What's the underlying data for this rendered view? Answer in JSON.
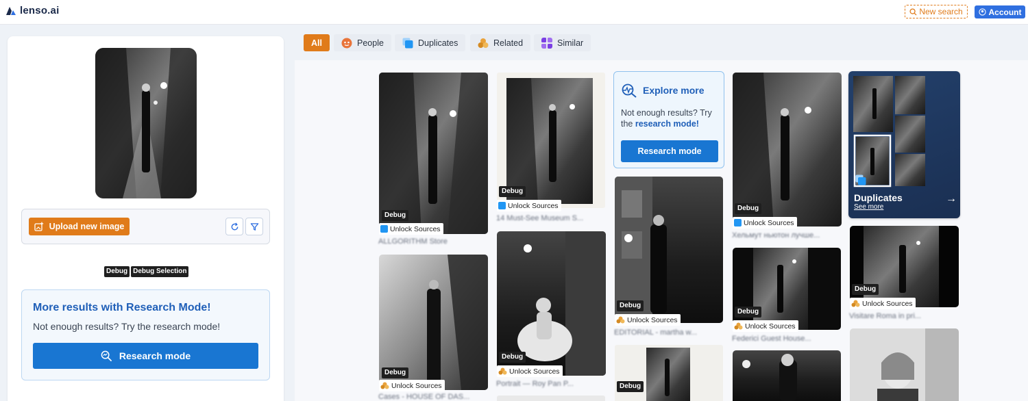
{
  "header": {
    "logo_text": "lenso.ai",
    "new_search_label": "New search",
    "account_label": "Account"
  },
  "left_panel": {
    "upload_label": "Upload new image",
    "debug_tags": [
      "Debug",
      "Debug Selection"
    ],
    "research_card": {
      "title": "More results with Research Mode!",
      "subtitle": "Not enough results? Try the research mode!",
      "button_label": "Research mode"
    }
  },
  "tabs": [
    {
      "label": "All",
      "icon": "all"
    },
    {
      "label": "People",
      "icon": "people-icon"
    },
    {
      "label": "Duplicates",
      "icon": "duplicates-icon"
    },
    {
      "label": "Related",
      "icon": "related-icon"
    },
    {
      "label": "Similar",
      "icon": "similar-icon"
    }
  ],
  "results": {
    "debug_label": "Debug",
    "unlock_label": "Unlock Sources",
    "titles": [
      "ALLGORITHM Store",
      "14 Must-See Museum S...",
      "Хельмут ньютон лучше...",
      "EDITORIAL - martha w...",
      "Visitare Roma in pri...",
      "Cases - HOUSE OF DAS...",
      "Portrait — Roy Pan P...",
      "Federici Guest House..."
    ]
  },
  "explore": {
    "title": "Explore more",
    "text_before": "Not enough results? Try the ",
    "text_bold": "research mode!",
    "button_label": "Research mode"
  },
  "duplicates_card": {
    "title": "Duplicates",
    "link": "See more"
  },
  "colors": {
    "accent_orange": "#e07b1a",
    "primary_blue": "#1976d2",
    "account_blue": "#2f6fe0"
  }
}
